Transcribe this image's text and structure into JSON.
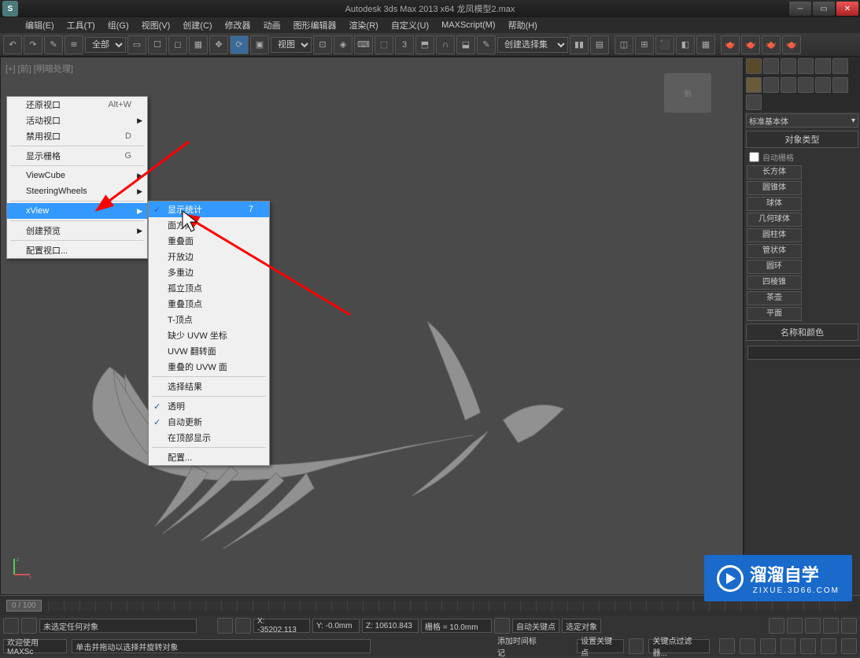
{
  "title": "Autodesk 3ds Max  2013 x64      龙凤模型2.max",
  "menubar": [
    "编辑(E)",
    "工具(T)",
    "组(G)",
    "视图(V)",
    "创建(C)",
    "修改器",
    "动画",
    "图形编辑器",
    "渲染(R)",
    "自定义(U)",
    "MAXScript(M)",
    "帮助(H)"
  ],
  "toolbar": {
    "sel1": "全部",
    "sel2": "视图",
    "sel3": "创建选择集"
  },
  "viewport": {
    "label": "[+] [前] [明暗处理]",
    "cube": "前"
  },
  "ctx1": {
    "items": [
      {
        "label": "还原视口",
        "shortcut": "Alt+W"
      },
      {
        "label": "活动视口",
        "arrow": true
      },
      {
        "label": "禁用视口",
        "shortcut": "D"
      },
      {
        "sep": true
      },
      {
        "label": "显示栅格",
        "shortcut": "G"
      },
      {
        "sep": true
      },
      {
        "label": "ViewCube",
        "arrow": true
      },
      {
        "label": "SteeringWheels",
        "arrow": true
      },
      {
        "sep": true
      },
      {
        "label": "xView",
        "arrow": true,
        "highlight": true
      },
      {
        "sep": true
      },
      {
        "label": "创建预览",
        "arrow": true
      },
      {
        "sep": true
      },
      {
        "label": "配置视口..."
      }
    ]
  },
  "ctx2": {
    "items": [
      {
        "label": "显示统计",
        "check": true,
        "highlight": true,
        "shortcut": "7"
      },
      {
        "label": "面方向"
      },
      {
        "label": "重叠面"
      },
      {
        "label": "开放边"
      },
      {
        "label": "多重边"
      },
      {
        "label": "孤立顶点"
      },
      {
        "label": "重叠顶点"
      },
      {
        "label": "T-顶点"
      },
      {
        "label": "缺少 UVW 坐标"
      },
      {
        "label": "UVW 翻转面"
      },
      {
        "label": "重叠的 UVW 面"
      },
      {
        "sep": true
      },
      {
        "label": "选择结果"
      },
      {
        "sep": true
      },
      {
        "label": "透明",
        "check": true
      },
      {
        "label": "自动更新",
        "check": true
      },
      {
        "label": "在顶部显示"
      },
      {
        "sep": true
      },
      {
        "label": "配置..."
      }
    ]
  },
  "rightpanel": {
    "dropdown": "标准基本体",
    "section1": "对象类型",
    "autogrid": "自动栅格",
    "buttons": [
      "长方体",
      "圆锥体",
      "球体",
      "几何球体",
      "圆柱体",
      "管状体",
      "圆环",
      "四棱锥",
      "茶壶",
      "平面"
    ],
    "section2": "名称和颜色"
  },
  "timeline": {
    "frame": "0 / 100"
  },
  "status": {
    "selection": "未选定任何对象",
    "x": "X: -35202.113",
    "y": "Y: -0.0mm",
    "z": "Z: 10610.843",
    "grid": "栅格 = 10.0mm",
    "autokey": "自动关键点",
    "selobj": "选定对象",
    "welcome": "欢迎使用 MAXSc",
    "hint": "单击并拖动以选择并旋转对象",
    "setkey": "设置关键点",
    "keyfilter": "关键点过滤器...",
    "addtime": "添加时间标记"
  },
  "watermark": {
    "title": "溜溜自学",
    "sub": "ZIXUE.3D66.COM"
  }
}
